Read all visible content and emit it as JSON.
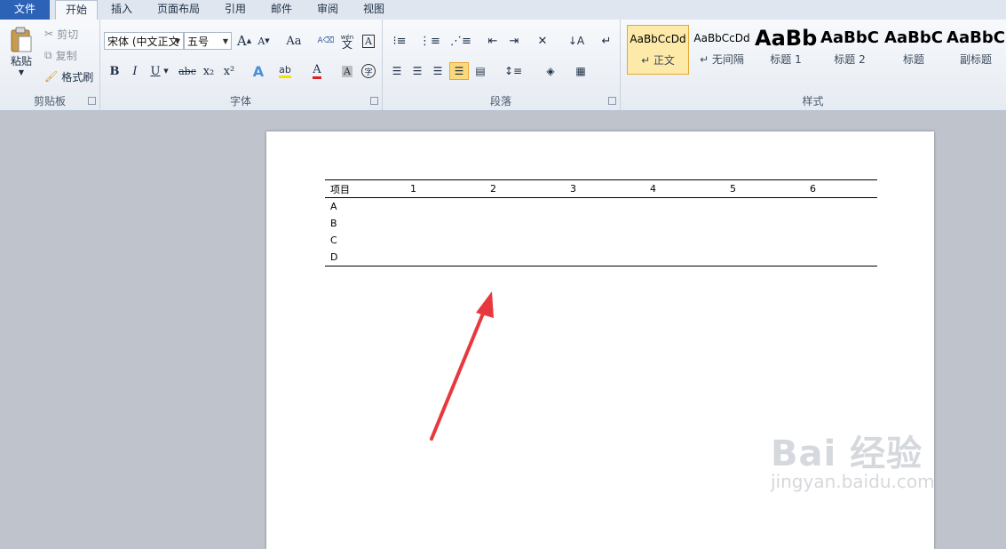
{
  "tabs": [
    {
      "label": "文件"
    },
    {
      "label": "开始"
    },
    {
      "label": "插入"
    },
    {
      "label": "页面布局"
    },
    {
      "label": "引用"
    },
    {
      "label": "邮件"
    },
    {
      "label": "审阅"
    },
    {
      "label": "视图"
    }
  ],
  "clipboard": {
    "paste": "粘贴",
    "cut": "剪切",
    "copy": "复制",
    "format_painter": "格式刷",
    "label": "剪贴板"
  },
  "font": {
    "name": "宋体 (中文正文",
    "size": "五号",
    "label": "字体",
    "bold": "B",
    "italic": "I",
    "underline": "U",
    "strike": "abc",
    "subscript": "x₂",
    "superscript": "x²",
    "grow": "A",
    "shrink": "A",
    "case": "Aa",
    "font_color": "A",
    "char_shading": "A",
    "enclose": "字",
    "phonetic": "wén",
    "phonetic_char": "文",
    "border_char": "A"
  },
  "paragraph": {
    "label": "段落"
  },
  "styles": {
    "label": "样式",
    "items": [
      {
        "sample": "AaBbCcDd",
        "name": "↵ 正文"
      },
      {
        "sample": "AaBbCcDd",
        "name": "↵ 无间隔"
      },
      {
        "sample": "AaBb",
        "name": "标题 1"
      },
      {
        "sample": "AaBbC",
        "name": "标题 2"
      },
      {
        "sample": "AaBbC",
        "name": "标题"
      },
      {
        "sample": "AaBbC",
        "name": "副标题"
      }
    ]
  },
  "table": {
    "header": [
      "项目",
      "1",
      "2",
      "3",
      "4",
      "5",
      "6"
    ],
    "rows": [
      [
        "A",
        "",
        "",
        "",
        "",
        "",
        ""
      ],
      [
        "B",
        "",
        "",
        "",
        "",
        "",
        ""
      ],
      [
        "C",
        "",
        "",
        "",
        "",
        "",
        ""
      ],
      [
        "D",
        "",
        "",
        "",
        "",
        "",
        ""
      ]
    ]
  },
  "watermark": {
    "line1": "Bai 经验",
    "line2": "jingyan.baidu.com"
  },
  "colors": {
    "file_tab": "#2c63b7",
    "arrow": "#e8383d",
    "highlight": "#fbd97b"
  }
}
